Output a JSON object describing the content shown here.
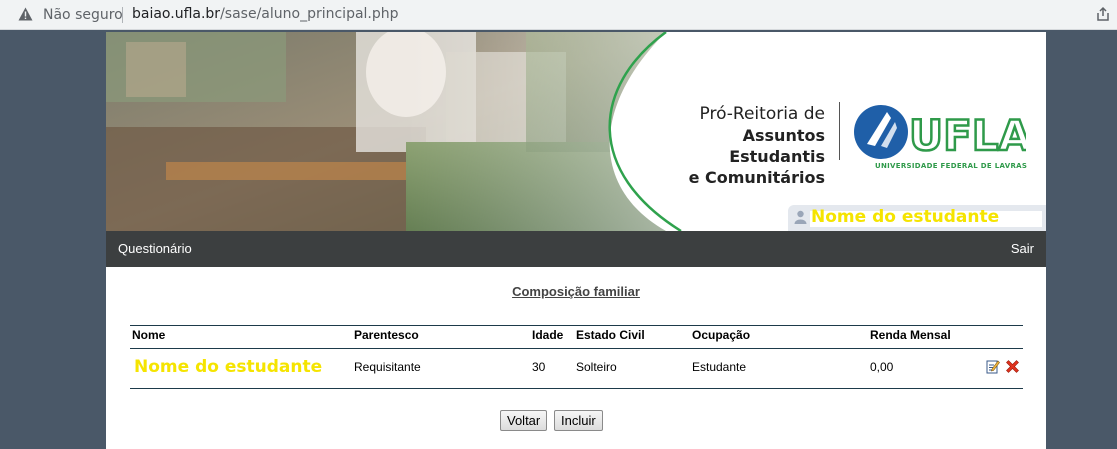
{
  "browser": {
    "security_label": "Não seguro",
    "url_host": "baiao.ufla.br",
    "url_path": "/sase/aluno_principal.php"
  },
  "banner": {
    "line1": "Pró-Reitoria de",
    "line2": "Assuntos Estudantis",
    "line3": "e Comunitários",
    "logo_text": "UFLA",
    "logo_subtitle": "UNIVERSIDADE FEDERAL DE LAVRAS",
    "student_name": "Nome do estudante"
  },
  "menu": {
    "questionario": "Questionário",
    "sair": "Sair"
  },
  "section": {
    "title": "Composição familiar"
  },
  "table": {
    "headers": {
      "nome": "Nome",
      "parentesco": "Parentesco",
      "idade": "Idade",
      "estado_civil": "Estado Civil",
      "ocupacao": "Ocupação",
      "renda": "Renda Mensal"
    },
    "rows": [
      {
        "nome": "Nome do estudante",
        "parentesco": "Requisitante",
        "idade": "30",
        "estado_civil": "Solteiro",
        "ocupacao": "Estudante",
        "renda": "0,00"
      }
    ]
  },
  "buttons": {
    "voltar": "Voltar",
    "incluir": "Incluir"
  },
  "colors": {
    "ufla_blue": "#1f5fa8",
    "ufla_green": "#2f9a4a",
    "highlight_yellow": "#f5e400",
    "menubar": "#3c3f40",
    "delete_red": "#e0321e"
  }
}
